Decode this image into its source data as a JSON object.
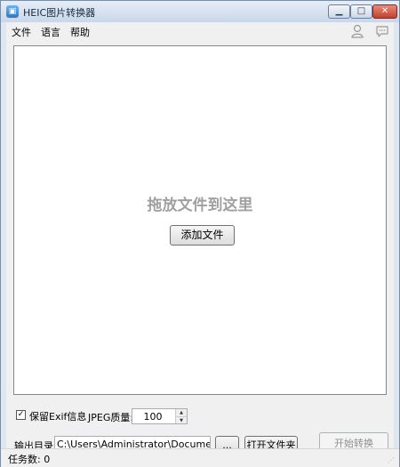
{
  "window": {
    "title": "HEIC图片转换器",
    "icon": "app-icon",
    "controls": {
      "minimize": "▁",
      "maximize": "□",
      "close": "✕"
    }
  },
  "menu": {
    "items": [
      "文件",
      "语言",
      "帮助"
    ],
    "user_icon": "user-icon",
    "chat_icon": "chat-icon"
  },
  "dropzone": {
    "hint": "拖放文件到这里",
    "add_button": "添加文件"
  },
  "options": {
    "keep_exif_label": "保留Exif信息",
    "keep_exif_checked": true,
    "jpeg_quality_label": "JPEG质量:",
    "jpeg_quality_value": "100"
  },
  "output": {
    "label": "输出目录:",
    "path": "C:\\Users\\Administrator\\Documents\\Ape",
    "browse_label": "...",
    "open_folder_label": "打开文件夹",
    "start_label": "开始转换"
  },
  "status": {
    "task_count": "任务数: 0"
  },
  "colors": {
    "frame": "#7a8ea8",
    "close_button": "#c2412d",
    "hint_text": "#a0a0a0",
    "disabled_text": "#8d8d8d"
  }
}
